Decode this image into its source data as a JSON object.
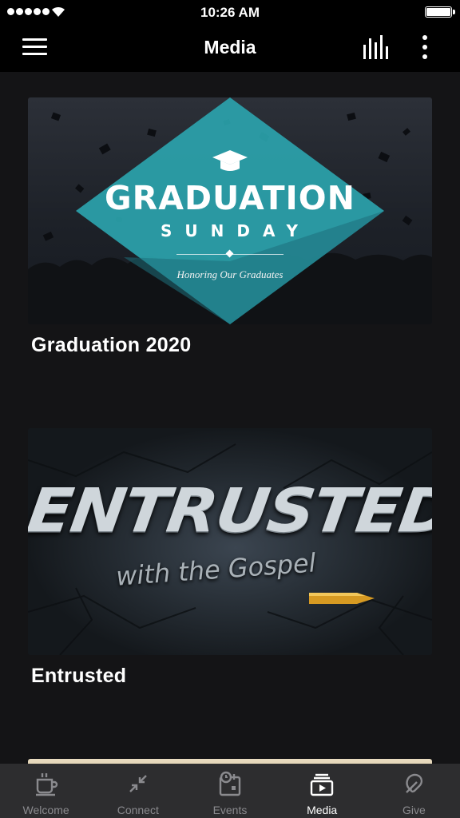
{
  "status_bar": {
    "time": "10:26 AM"
  },
  "nav": {
    "title": "Media"
  },
  "feed": {
    "items": [
      {
        "title": "Graduation 2020",
        "artwork": {
          "headline": "GRADUATION",
          "subhead": "SUNDAY",
          "tagline": "Honoring Our Graduates"
        }
      },
      {
        "title": "Entrusted",
        "artwork": {
          "headline": "ENTRUSTED",
          "subhead": "with the Gospel"
        }
      }
    ]
  },
  "tab_bar": {
    "tabs": [
      {
        "label": "Welcome",
        "icon": "coffee-cup-icon",
        "active": false
      },
      {
        "label": "Connect",
        "icon": "arrows-inward-icon",
        "active": false
      },
      {
        "label": "Events",
        "icon": "calendar-clock-icon",
        "active": false
      },
      {
        "label": "Media",
        "icon": "media-play-icon",
        "active": true
      },
      {
        "label": "Give",
        "icon": "give-icon",
        "active": false
      }
    ]
  },
  "colors": {
    "teal_accent": "#2ba3ad",
    "tab_bar_bg": "#2d2d2f",
    "tab_inactive": "#8a8a8e"
  }
}
